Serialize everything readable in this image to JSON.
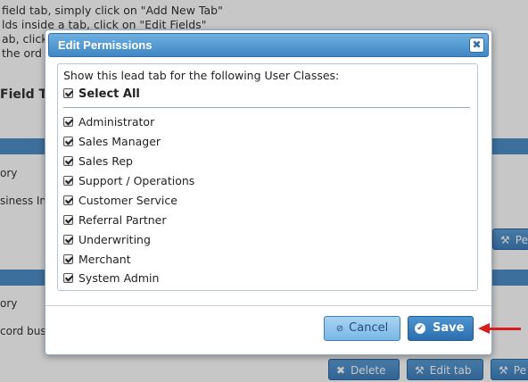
{
  "background": {
    "lines": [
      "field tab, simply click on \"Add New Tab\"",
      "lds inside a tab, click on \"Edit Fields\"",
      "ab, click",
      "the ord"
    ],
    "heading": "Field T",
    "row1_a": "ory",
    "row1_b": "siness In",
    "row2_a": "ory",
    "row2_b": "cord bus",
    "buttons": {
      "pe1": "Pe",
      "delete": "Delete",
      "edit_tab": "Edit tab",
      "pe2": "Pe"
    }
  },
  "dialog": {
    "title": "Edit Permissions",
    "intro": "Show this lead tab for the following User Classes:",
    "select_all": "Select All",
    "options": [
      {
        "label": "Administrator",
        "checked": true
      },
      {
        "label": "Sales Manager",
        "checked": true
      },
      {
        "label": "Sales Rep",
        "checked": true
      },
      {
        "label": "Support / Operations",
        "checked": true
      },
      {
        "label": "Customer Service",
        "checked": true
      },
      {
        "label": "Referral Partner",
        "checked": true
      },
      {
        "label": "Underwriting",
        "checked": true
      },
      {
        "label": "Merchant",
        "checked": true
      },
      {
        "label": "System Admin",
        "checked": true
      }
    ],
    "cancel_label": "Cancel",
    "save_label": "Save"
  },
  "colors": {
    "accent": "#3f87c4",
    "annotation_arrow": "#d91b1b"
  }
}
